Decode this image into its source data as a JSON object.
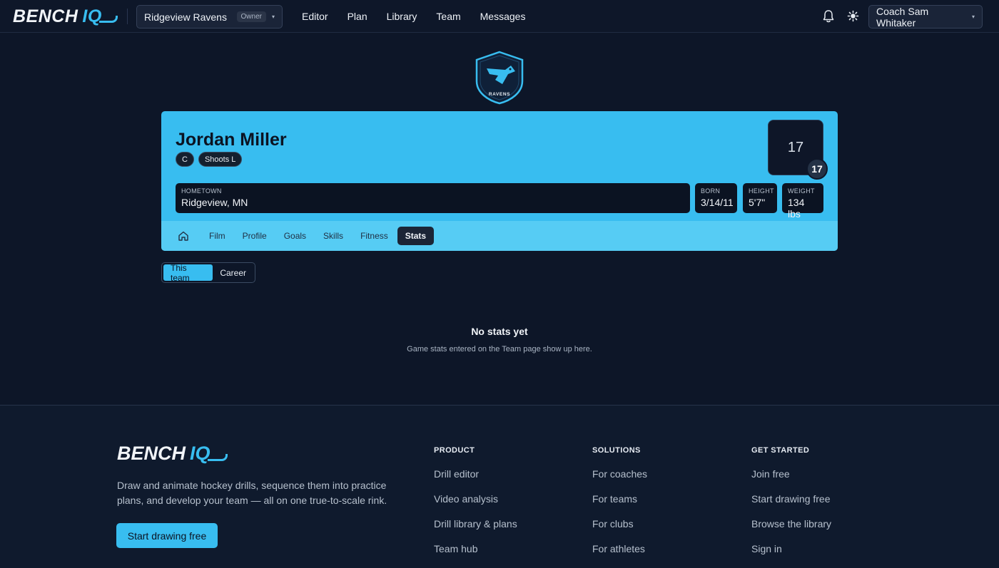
{
  "brand": {
    "part1": "BENCH",
    "part2": "IQ"
  },
  "team_select": {
    "name": "Ridgeview Ravens ...",
    "role": "Owner"
  },
  "nav": {
    "links": [
      "Editor",
      "Plan",
      "Library",
      "Team",
      "Messages"
    ]
  },
  "user": {
    "name": "Coach Sam Whitaker"
  },
  "crest": {
    "text": "RAVENS"
  },
  "player": {
    "name": "Jordan Miller",
    "position": "C",
    "shoots": "Shoots L",
    "number": "17",
    "badge_number": "17",
    "hometown_label": "HOMETOWN",
    "hometown": "Ridgeview, MN",
    "born_label": "BORN",
    "born": "3/14/11",
    "height_label": "HEIGHT",
    "height": "5'7\"",
    "weight_label": "WEIGHT",
    "weight": "134 lbs"
  },
  "tabs": [
    "Film",
    "Profile",
    "Goals",
    "Skills",
    "Fitness",
    "Stats"
  ],
  "active_tab": "Stats",
  "segment": {
    "this_team": "This team",
    "career": "Career"
  },
  "empty": {
    "title": "No stats yet",
    "subtitle": "Game stats entered on the Team page show up here."
  },
  "footer": {
    "tagline": "Draw and animate hockey drills, sequence them into practice plans, and develop your team — all on one true-to-scale rink.",
    "cta": "Start drawing free",
    "columns": [
      {
        "heading": "PRODUCT",
        "links": [
          "Drill editor",
          "Video analysis",
          "Drill library & plans",
          "Team hub"
        ]
      },
      {
        "heading": "SOLUTIONS",
        "links": [
          "For coaches",
          "For teams",
          "For clubs",
          "For athletes"
        ]
      },
      {
        "heading": "GET STARTED",
        "links": [
          "Join free",
          "Start drawing free",
          "Browse the library",
          "Sign in"
        ]
      }
    ]
  },
  "colors": {
    "accent": "#38bdf0",
    "background": "#0d1628",
    "tab_bar": "#56ccf4"
  },
  "icons": [
    "bell-icon",
    "sun-icon",
    "home-icon",
    "chevron-down-icon",
    "raven-crest-icon"
  ]
}
